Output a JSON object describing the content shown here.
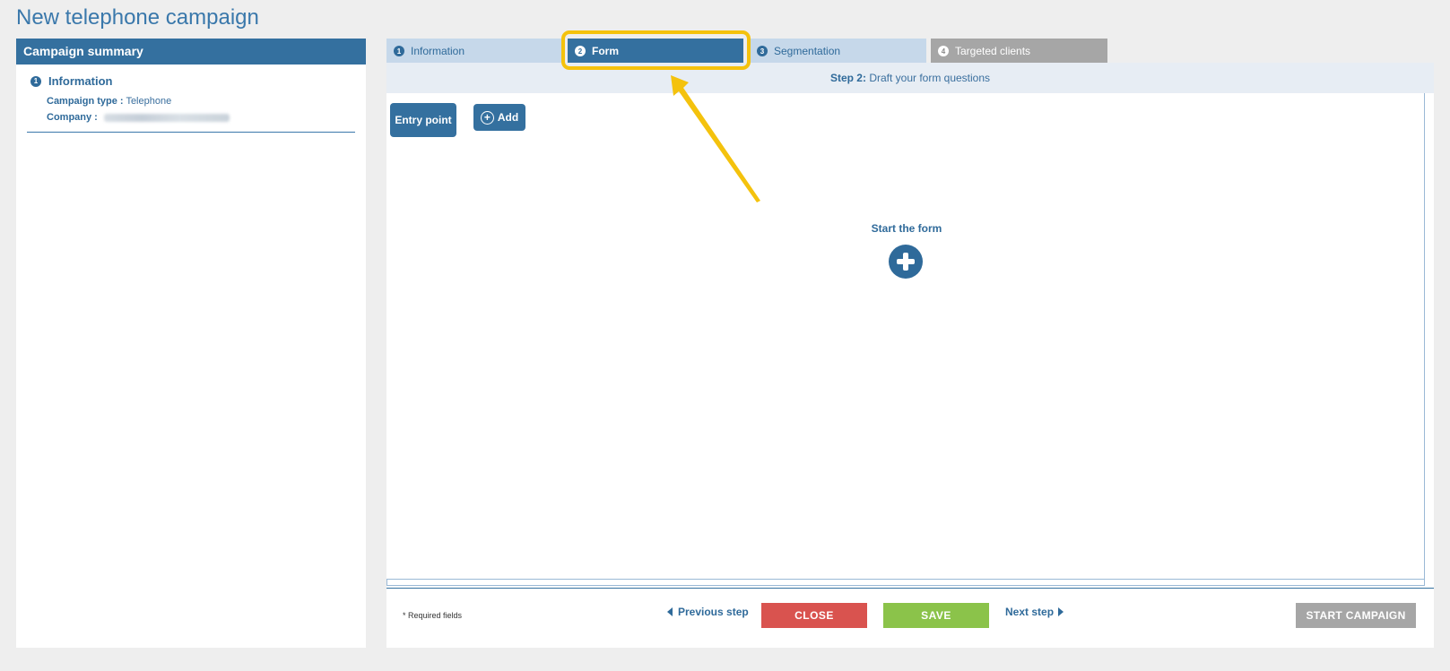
{
  "page": {
    "title": "New telephone campaign"
  },
  "sidebar": {
    "header": "Campaign summary",
    "section": {
      "number": "1",
      "title": "Information",
      "campaign_type_label": "Campaign type :",
      "campaign_type_value": "Telephone",
      "company_label": "Company :"
    }
  },
  "tabs": [
    {
      "number": "1",
      "label": "Information",
      "state": "inactive"
    },
    {
      "number": "2",
      "label": "Form",
      "state": "active"
    },
    {
      "number": "3",
      "label": "Segmentation",
      "state": "inactive"
    },
    {
      "number": "4",
      "label": "Targeted clients",
      "state": "disabled"
    }
  ],
  "step_bar": {
    "step": "Step 2:",
    "text": "Draft your form questions"
  },
  "canvas": {
    "entry_point_label": "Entry point",
    "add_label": "Add",
    "start_label": "Start the form"
  },
  "footer": {
    "required_note": "* Required fields",
    "previous_step": "Previous step",
    "close": "CLOSE",
    "save": "SAVE",
    "next_step": "Next step",
    "start_campaign": "START CAMPAIGN"
  },
  "colors": {
    "primary": "#34709f",
    "highlight": "#f4c20d",
    "close": "#d9534f",
    "save": "#8bc34a",
    "disabled": "#a6a6a6"
  }
}
